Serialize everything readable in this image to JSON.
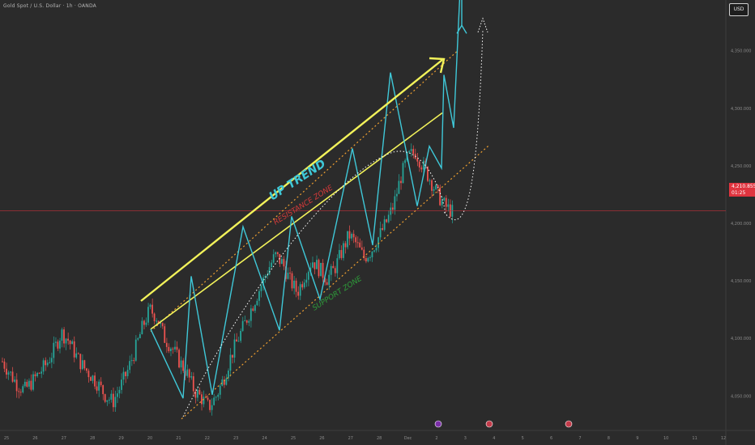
{
  "header": {
    "instrument_title": "Gold Spot / U.S. Dollar · 1h · OANDA",
    "currency_badge": "USD"
  },
  "last_price": {
    "value": "4,210.855",
    "countdown": "01:25"
  },
  "colors": {
    "background": "#2b2b2b",
    "up_candle": "#26a69a",
    "down_candle": "#ef5350",
    "zigzag": "#3fc8d8",
    "trend_arrow": "#f2f25a",
    "support_line": "#f2f25a",
    "channel_dots": "#f0a030",
    "resistance_label": "#d63a3a",
    "support_label": "#2e9d3a",
    "current_price_line": "#c0303a"
  },
  "annotations": {
    "up_trend": "UP TREND",
    "resistance_zone": "RESISTANCE ZONE",
    "support_zone": "SUPPORT ZONE"
  },
  "event_icons": [
    "event-icon",
    "us-flag-icon",
    "us-flag-icon"
  ],
  "chart_data": {
    "type": "candlestick",
    "title": "",
    "y_axis": {
      "range": [
        4020,
        4380
      ],
      "tick_labels": [
        "4,350.000",
        "4,300.000",
        "4,250.000",
        "4,200.000",
        "4,150.000",
        "4,100.000",
        "4,050.000"
      ]
    },
    "x_axis": {
      "tick_labels": [
        "25",
        "26",
        "27",
        "28",
        "29",
        "20",
        "21",
        "22",
        "23",
        "24",
        "25",
        "26",
        "27",
        "28",
        "Dec",
        "2",
        "3",
        "4",
        "5",
        "6",
        "7",
        "8",
        "9",
        "10",
        "11",
        "12"
      ]
    },
    "candles_close_path": [
      4080,
      4070,
      4060,
      4055,
      4062,
      4070,
      4078,
      4090,
      4105,
      4098,
      4085,
      4075,
      4068,
      4060,
      4050,
      4045,
      4058,
      4072,
      4090,
      4110,
      4125,
      4118,
      4100,
      4092,
      4080,
      4070,
      4055,
      4048,
      4040,
      4050,
      4065,
      4085,
      4100,
      4115,
      4130,
      4145,
      4160,
      4172,
      4165,
      4150,
      4140,
      4155,
      4168,
      4160,
      4152,
      4160,
      4175,
      4190,
      4182,
      4170,
      4176,
      4188,
      4200,
      4215,
      4240,
      4258,
      4262,
      4250,
      4238,
      4225,
      4215,
      4210
    ],
    "zigzag_path": [
      4108,
      4048,
      4154,
      4051,
      4197,
      4107,
      4206,
      4134,
      4265,
      4181,
      4331,
      4215,
      4267,
      4248,
      4329,
      4283,
      4434,
      4372,
      4372
    ],
    "channel": {
      "upper_start": 4106,
      "upper_end": 4350,
      "lower_start": 4030,
      "lower_end": 4268,
      "support_line": [
        4108,
        4296
      ]
    },
    "current_price": 4210.855,
    "grid": false
  }
}
